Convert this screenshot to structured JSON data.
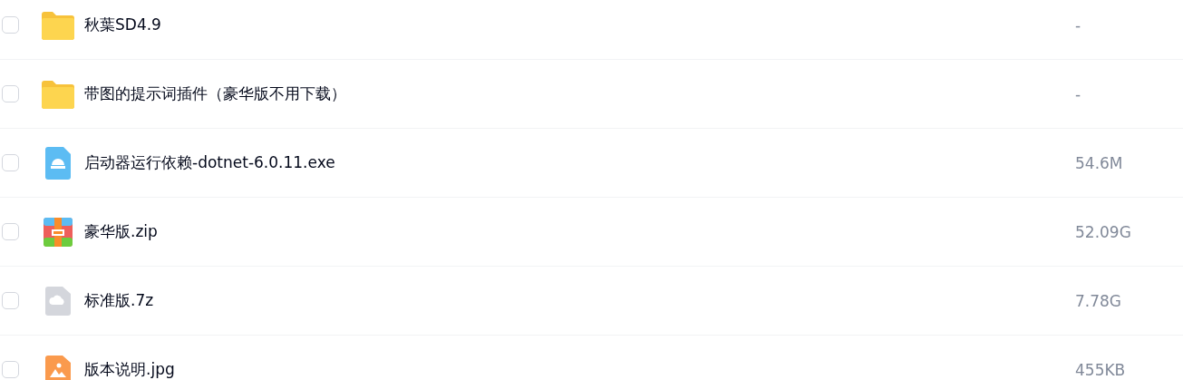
{
  "files": [
    {
      "name": "秋葉SD4.9",
      "size": "-",
      "kind": "folder",
      "checked": false
    },
    {
      "name": "带图的提示词插件（豪华版不用下载）",
      "size": "-",
      "kind": "folder",
      "checked": false
    },
    {
      "name": "启动器运行依赖-dotnet-6.0.11.exe",
      "size": "54.6M",
      "kind": "exe",
      "checked": false
    },
    {
      "name": "豪华版.zip",
      "size": "52.09G",
      "kind": "zip",
      "checked": false
    },
    {
      "name": "标准版.7z",
      "size": "7.78G",
      "kind": "cloud",
      "checked": false
    },
    {
      "name": "版本说明.jpg",
      "size": "455KB",
      "kind": "image",
      "checked": false
    }
  ]
}
